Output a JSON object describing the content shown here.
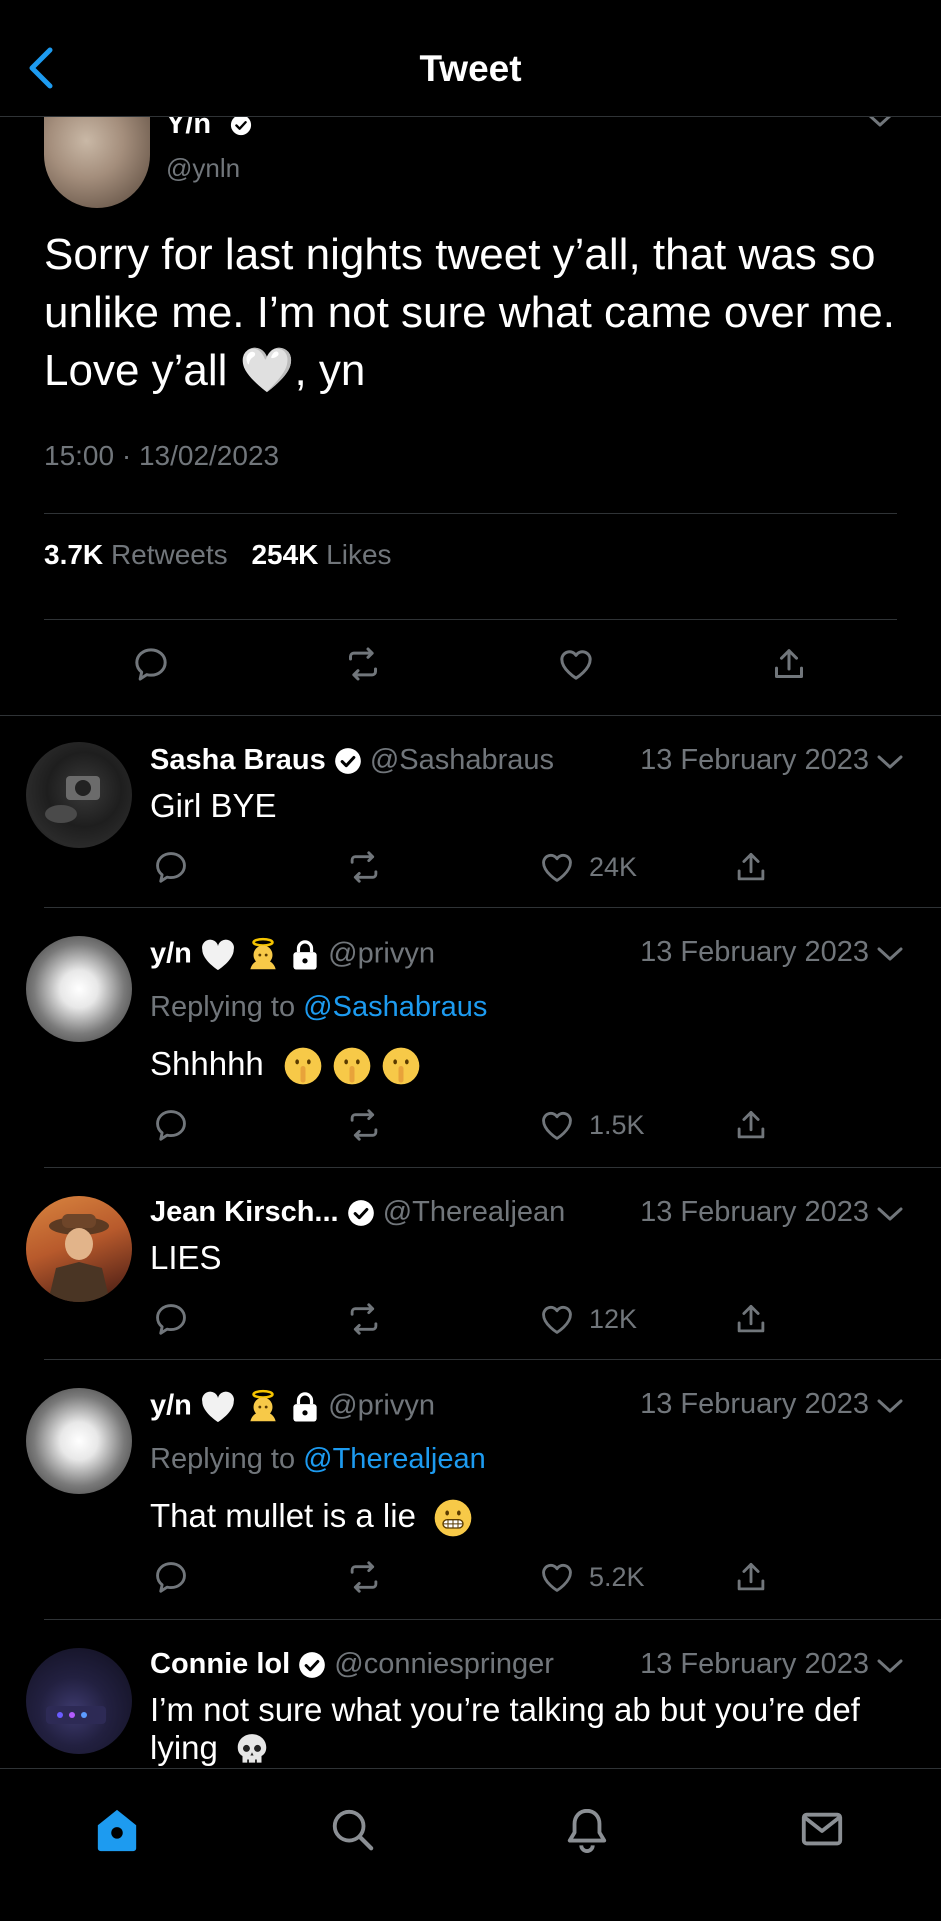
{
  "header": {
    "title": "Tweet",
    "back_icon": "chevron-left-icon"
  },
  "main_tweet": {
    "name": "Y/n",
    "handle": "@ynln",
    "text": "Sorry for last nights tweet y’all, that was so unlike me. I’m not sure what came over me. Love y’all 🤍, yn",
    "time": "15:00 · 13/02/2023",
    "retweets_count": "3.7K",
    "retweets_label": "Retweets",
    "likes_count": "254K",
    "likes_label": "Likes"
  },
  "replies": [
    {
      "name": "Sasha Braus",
      "handle": "@Sashabraus",
      "date": "13 February 2023",
      "text": "Girl BYE",
      "likes": "24K"
    },
    {
      "name": "y/n",
      "handle": "@privyn",
      "date": "13 February 2023",
      "replying_label": "Replying to",
      "replying_to": "@Sashabraus",
      "text": "Shhhhh",
      "likes": "1.5K"
    },
    {
      "name": "Jean Kirsch...",
      "handle": "@Therealjean",
      "date": "13 February 2023",
      "text": "LIES",
      "likes": "12K"
    },
    {
      "name": "y/n",
      "handle": "@privyn",
      "date": "13 February 2023",
      "replying_label": "Replying to",
      "replying_to": "@Therealjean",
      "text": "That mullet is a lie",
      "likes": "5.2K"
    },
    {
      "name": "Connie lol",
      "handle": "@conniespringer",
      "date": "13 February 2023",
      "text": "I’m not sure what you’re talking ab but you’re def lying"
    }
  ],
  "tabbar": {
    "items": [
      "home-icon",
      "search-icon",
      "notifications-icon",
      "messages-icon"
    ],
    "active_color": "#1d9bf0"
  },
  "colors": {
    "accent": "#1d9bf0",
    "background": "#000000",
    "muted": "#71767b"
  }
}
